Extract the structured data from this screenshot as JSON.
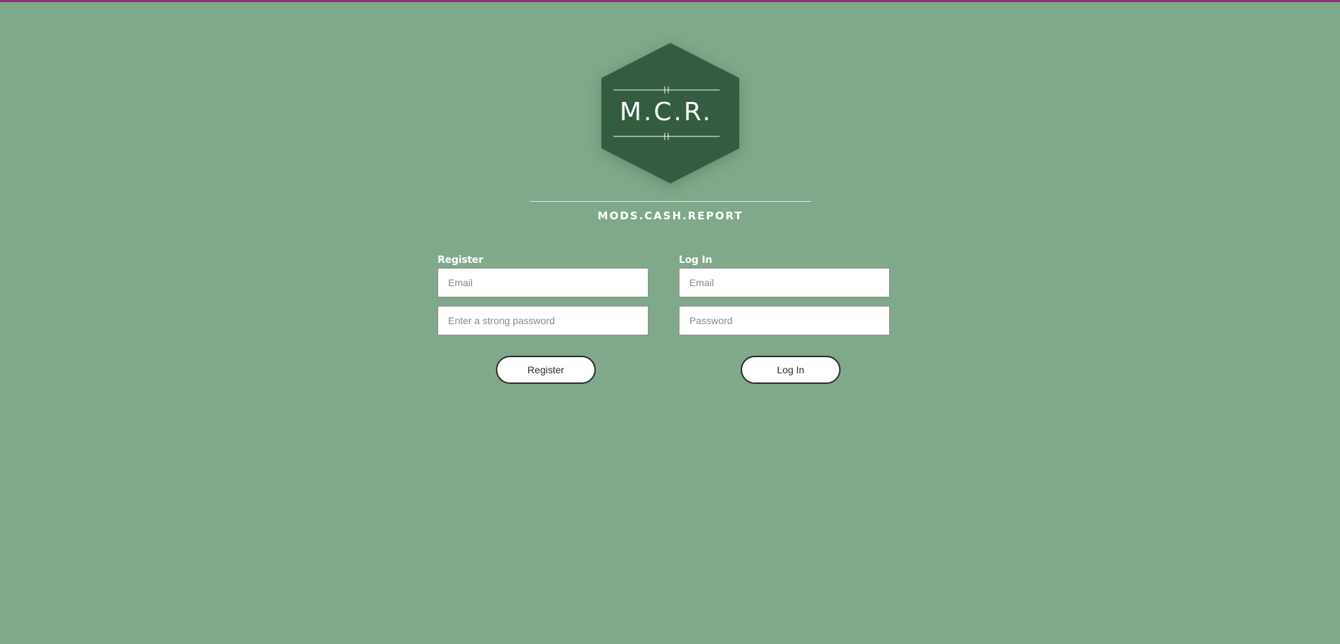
{
  "colors": {
    "background": "#7fa98a",
    "top_bar": "#8e2f7c",
    "logo_hexagon": "#335c40",
    "button_border": "#2b2b2b"
  },
  "logo": {
    "text": "M.C.R."
  },
  "site_name": "MODS.CASH.REPORT",
  "register": {
    "title": "Register",
    "email_placeholder": "Email",
    "email_value": "",
    "password_placeholder": "Enter a strong password",
    "password_value": "",
    "button_label": "Register"
  },
  "login": {
    "title": "Log In",
    "email_placeholder": "Email",
    "email_value": "",
    "password_placeholder": "Password",
    "password_value": "",
    "button_label": "Log In"
  }
}
